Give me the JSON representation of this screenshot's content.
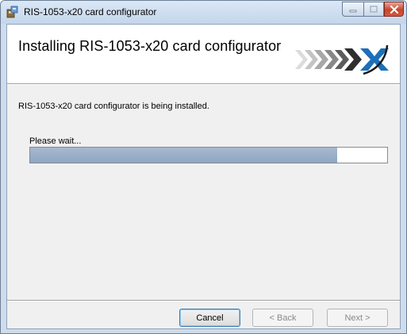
{
  "window": {
    "title": "RIS-1053-x20 card configurator",
    "accent": "#cfdcec"
  },
  "banner": {
    "title": "Installing RIS-1053-x20 card configurator",
    "logo_icon": "chevrons-x-logo"
  },
  "body": {
    "status_text": "RIS-1053-x20 card configurator is being installed.",
    "wait_text": "Please wait...",
    "progress_fraction": 0.86
  },
  "buttons": {
    "cancel": "Cancel",
    "back": "< Back",
    "next": "Next >"
  }
}
